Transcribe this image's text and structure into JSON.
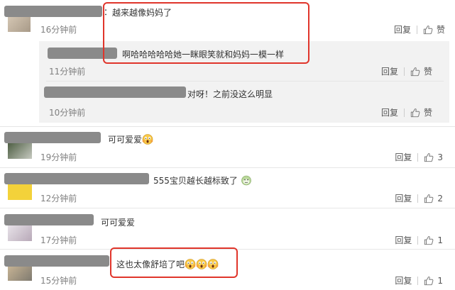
{
  "actions": {
    "reply": "回复",
    "like": "赞"
  },
  "comments": [
    {
      "text": "越来越像妈妈了",
      "time": "16分钟前",
      "like_count": "赞"
    },
    {
      "text": "可可爱爱",
      "time": "19分钟前",
      "like_count": "3"
    },
    {
      "text": "555宝贝越长越标致了",
      "time": "12分钟前",
      "like_count": "2"
    },
    {
      "text": "可可爱爱",
      "time": "17分钟前",
      "like_count": "1"
    },
    {
      "text": "这也太像舒培了吧",
      "time": "15分钟前",
      "like_count": "1"
    }
  ],
  "replies": [
    {
      "text": "啊哈哈哈哈哈她一眯眼笑就和妈妈一模一样",
      "time": "11分钟前",
      "like_count": "赞"
    },
    {
      "text": "对呀！之前没这么明显",
      "time": "10分钟前",
      "like_count": "赞"
    }
  ],
  "colors": {
    "highlight": "#e0352b",
    "background": "#ffffff",
    "reply_bg": "#f2f2f2",
    "redaction": "#8a8a8a"
  },
  "icons": {
    "like": "thumbs-up-icon",
    "emoji_scream": "face-screaming-emoji",
    "emoji_monkey": "monkey-face-emoji"
  }
}
